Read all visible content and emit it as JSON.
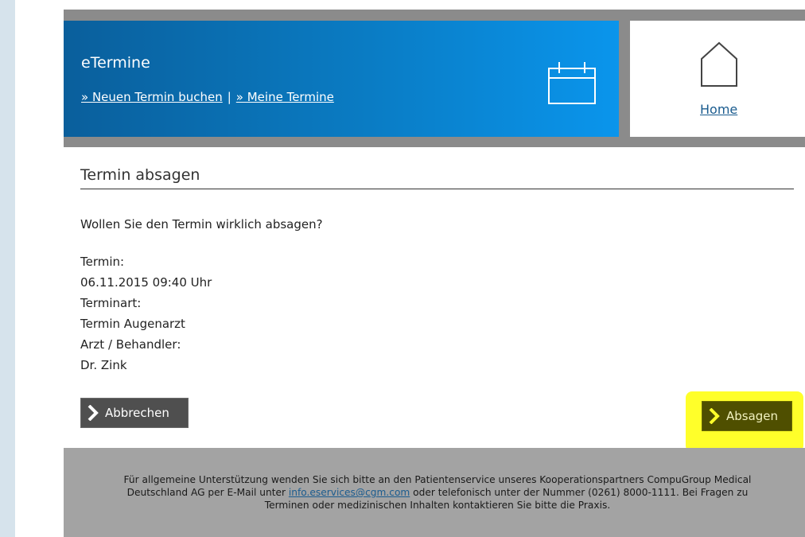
{
  "header": {
    "title": "eTermine",
    "link_new": "» Neuen Termin buchen",
    "separator": "|",
    "link_mine": "» Meine Termine",
    "calendar_icon": "calendar-icon"
  },
  "home": {
    "label": "Home",
    "icon": "house-icon"
  },
  "page": {
    "title": "Termin absagen",
    "question": "Wollen Sie den Termin wirklich absagen?",
    "details": [
      "Termin:",
      "06.11.2015 09:40 Uhr",
      "Terminart:",
      "Termin Augenarzt",
      "Arzt / Behandler:",
      "Dr. Zink"
    ]
  },
  "buttons": {
    "cancel": "Abbrechen",
    "confirm": "Absagen"
  },
  "footer": {
    "text_before": "Für allgemeine Unterstützung wenden Sie sich bitte an den Patientenservice unseres Kooperationspartners CompuGroup Medical Deutschland AG per E-Mail unter",
    "email": "info.eservices@cgm.com",
    "text_after": "oder telefonisch unter der Nummer (0261) 8000-1111. Bei Fragen zu Terminen oder medizinischen Inhalten kontaktieren Sie bitte die Praxis."
  },
  "colors": {
    "header_blue": "#0a7cc4",
    "frame_gray": "#8b8b8b",
    "footer_gray": "#a3a3a3",
    "highlight": "#ffff2a"
  }
}
